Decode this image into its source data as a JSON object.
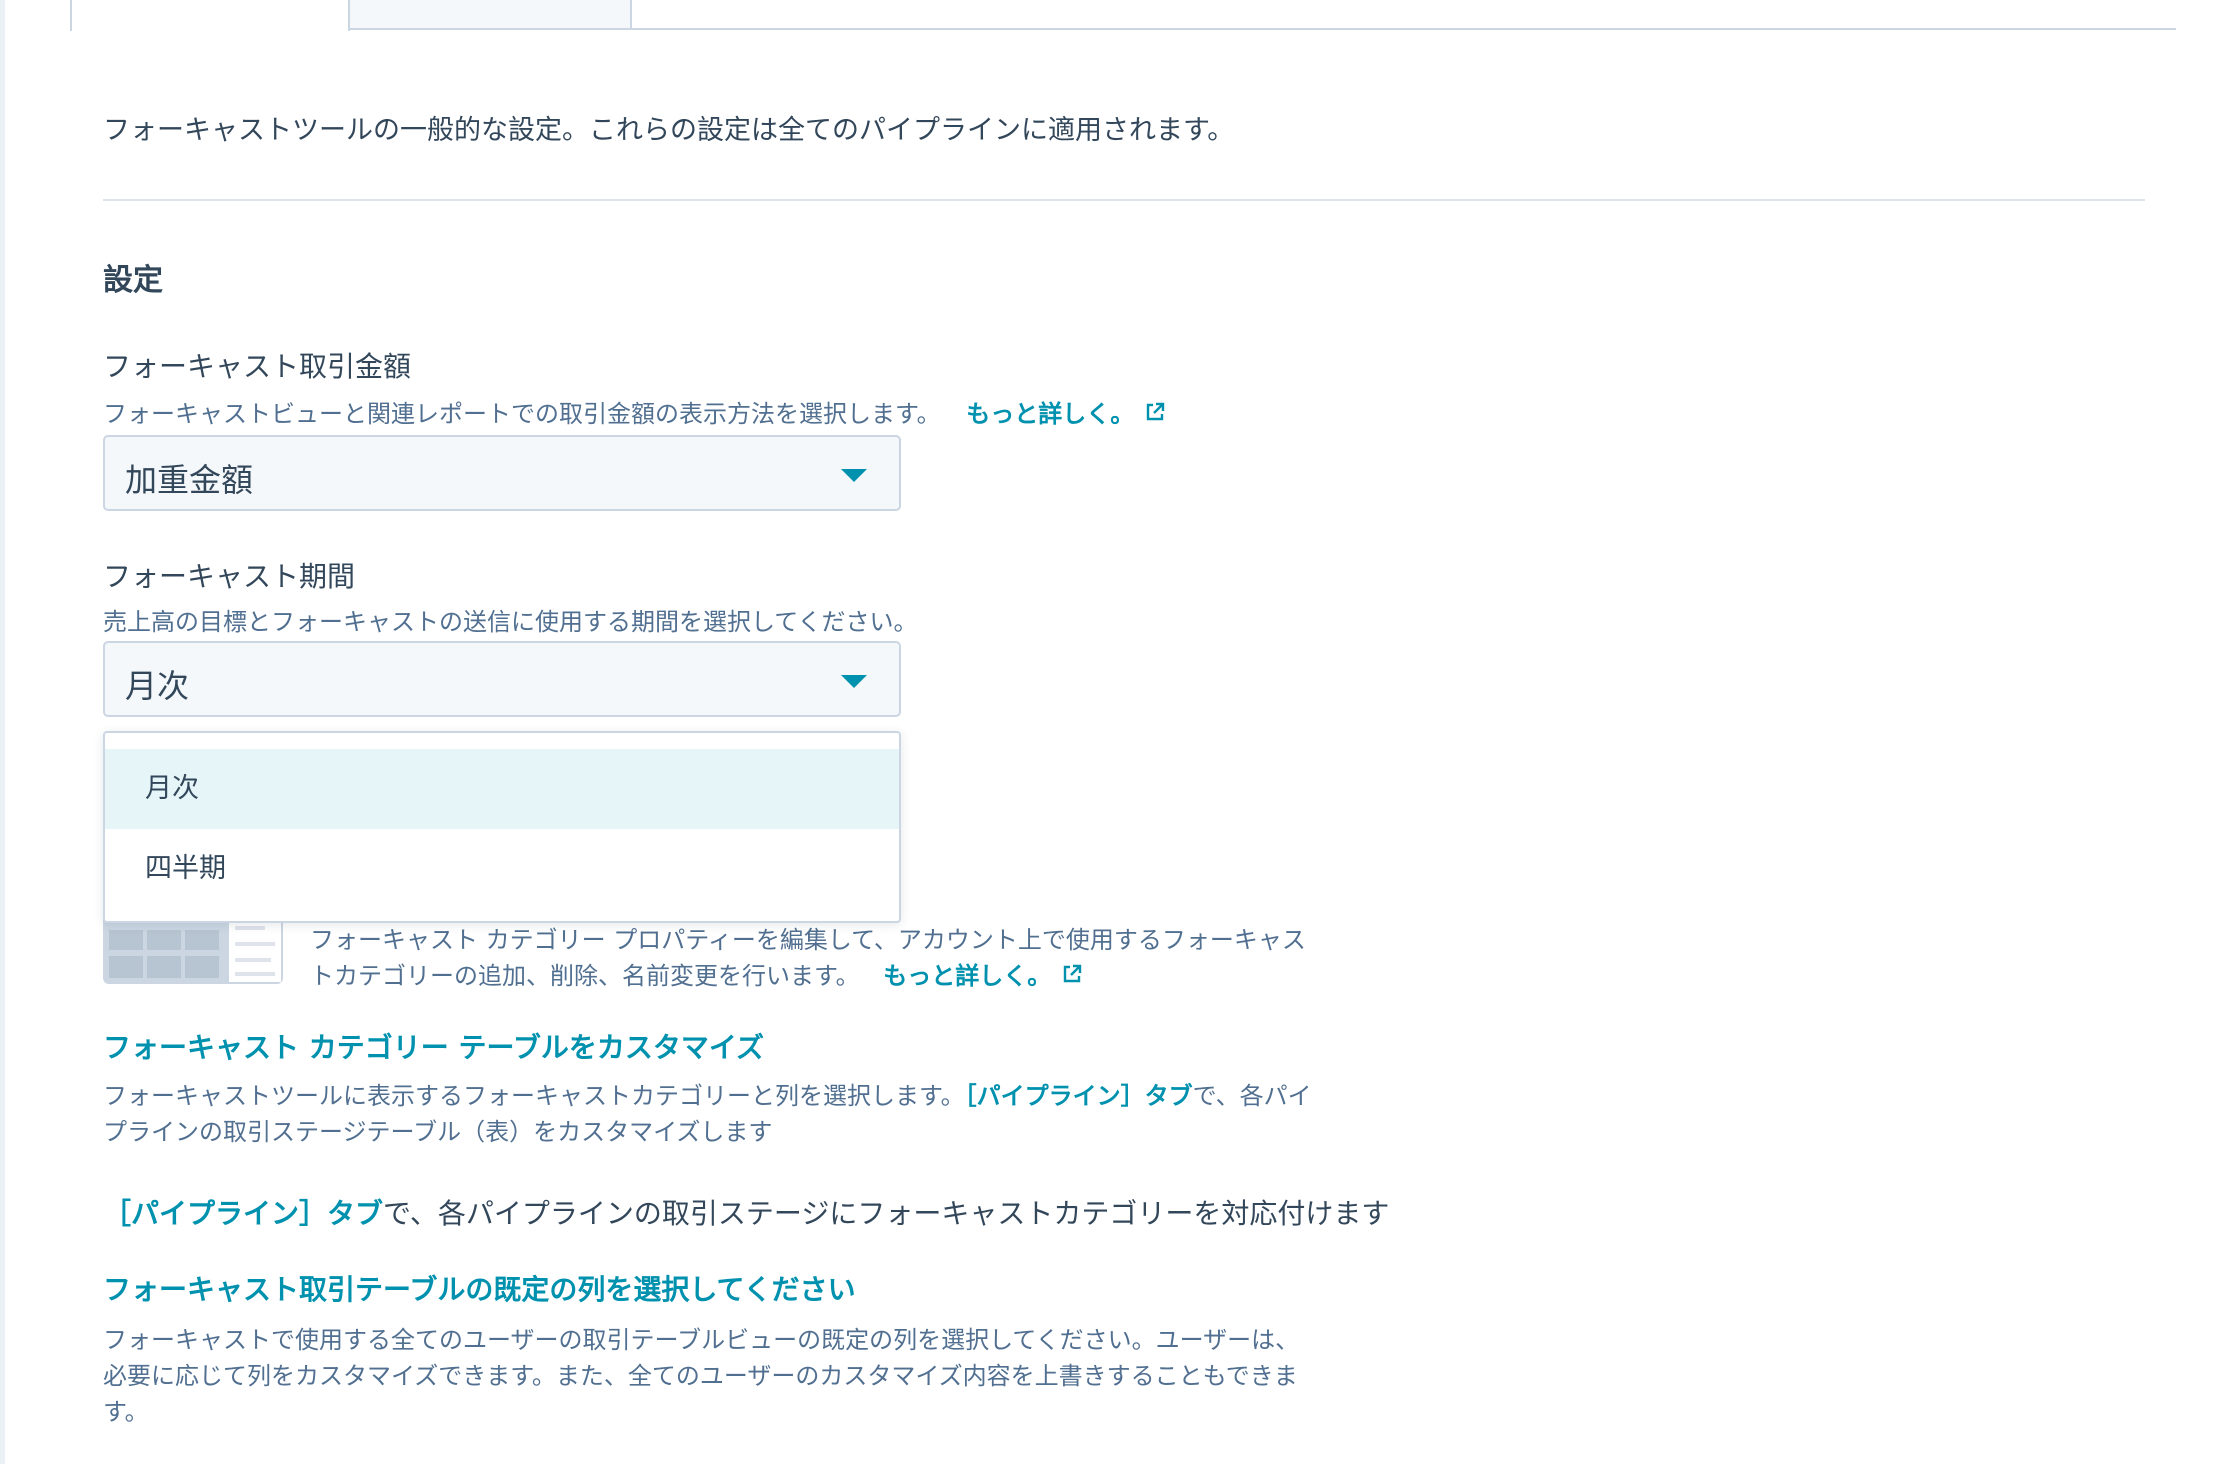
{
  "intro": "フォーキャストツールの一般的な設定。これらの設定は全てのパイプラインに適用されます。",
  "section_title": "設定",
  "amount": {
    "label": "フォーキャスト取引金額",
    "help": "フォーキャストビューと関連レポートでの取引金額の表示方法を選択します。",
    "link": "もっと詳しく。",
    "value": "加重金額"
  },
  "period": {
    "label": "フォーキャスト期間",
    "help": "売上高の目標とフォーキャストの送信に使用する期間を選択してください。",
    "value": "月次",
    "options": [
      "月次",
      "四半期"
    ]
  },
  "category": {
    "help_line1": "フォーキャスト カテゴリー プロパティーを編集して、アカウント上で使用するフォーキャス",
    "help_line2": "トカテゴリーの追加、削除、名前変更を行います。",
    "link": "もっと詳しく。"
  },
  "customize": {
    "title": "フォーキャスト カテゴリー テーブルをカスタマイズ",
    "line1_pre": "フォーキャストツールに表示するフォーキャストカテゴリーと列を選択します。",
    "line1_link": "［パイプライン］タブ",
    "line1_post": "で、各パイ",
    "line2": "プラインの取引ステージテーブル（表）をカスタマイズします"
  },
  "mapping": {
    "link": "［パイプライン］タブ",
    "text": "で、各パイプラインの取引ステージにフォーキャストカテゴリーを対応付けます"
  },
  "default_cols": {
    "title": "フォーキャスト取引テーブルの既定の列を選択してください",
    "line1": "フォーキャストで使用する全てのユーザーの取引テーブルビューの既定の列を選択してください。ユーザーは、",
    "line2": "必要に応じて列をカスタマイズできます。また、全てのユーザーのカスタマイズ内容を上書きすることもできま",
    "line3": "す。"
  },
  "colors": {
    "link": "#0091ae",
    "text": "#33475b",
    "muted": "#516f90",
    "selected_bg": "#e5f5f8"
  },
  "icons": [
    "external-link-icon",
    "caret-down-icon",
    "table-illustration"
  ]
}
